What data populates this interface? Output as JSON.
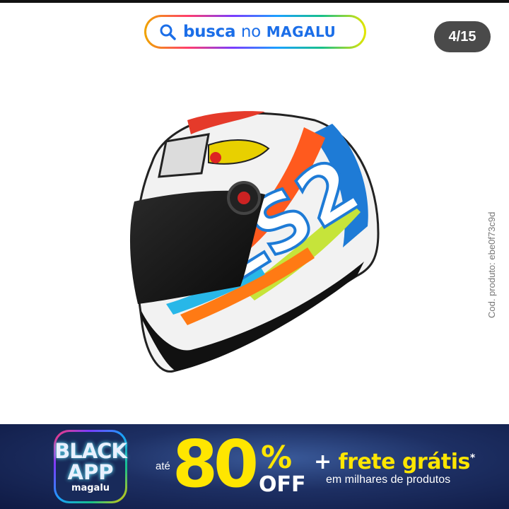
{
  "search": {
    "word1": "busca",
    "word2": "no",
    "brand": "MAGALU"
  },
  "gallery": {
    "counter": "4/15"
  },
  "product": {
    "code_text": "Cod. produto: ebe0f73c9d",
    "helmet_brand": "LS2"
  },
  "banner": {
    "badge_line1": "BLACK",
    "badge_line2": "APP",
    "badge_brand": "magalu",
    "ate": "até",
    "percent_number": "80",
    "percent_sign": "%",
    "off": "OFF",
    "plus": "+",
    "frete": "frete grátis",
    "asterisk": "*",
    "subline": "em milhares de produtos"
  },
  "colors": {
    "brand_blue": "#1b6ee8",
    "banner_bg": "#1d2f63",
    "promo_yellow": "#ffe600",
    "counter_bg": "#4a4a4a"
  }
}
